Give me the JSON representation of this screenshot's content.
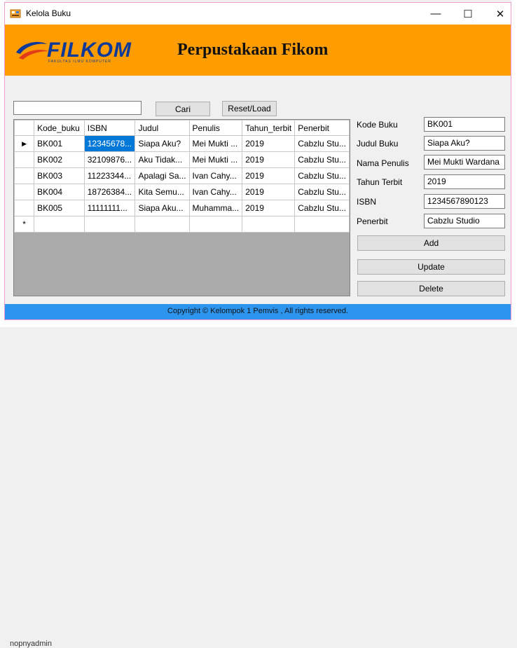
{
  "window": {
    "title": "Kelola Buku",
    "minimize_glyph": "—",
    "maximize_glyph": "☐",
    "close_glyph": "✕"
  },
  "header": {
    "logo_text": "FILKOM",
    "logo_subtext": "FAKULTAS ILMU KOMPUTER",
    "title": "Perpustakaan Fikom",
    "background_color": "#ff9d00"
  },
  "search": {
    "value": "",
    "search_label": "Cari",
    "reset_label": "Reset/Load"
  },
  "grid": {
    "columns": [
      "Kode_buku",
      "ISBN",
      "Judul",
      "Penulis",
      "Tahun_terbit",
      "Penerbit"
    ],
    "rows": [
      [
        "BK001",
        "12345678...",
        "Siapa Aku?",
        "Mei Mukti ...",
        "2019",
        "Cabzlu Stu..."
      ],
      [
        "BK002",
        "32109876...",
        "Aku Tidak...",
        "Mei Mukti ...",
        "2019",
        "Cabzlu Stu..."
      ],
      [
        "BK003",
        "11223344...",
        "Apalagi Sa...",
        "Ivan Cahy...",
        "2019",
        "Cabzlu Stu..."
      ],
      [
        "BK004",
        "18726384...",
        "Kita Semu...",
        "Ivan Cahy...",
        "2019",
        "Cabzlu Stu..."
      ],
      [
        "BK005",
        "11111111...",
        "Siapa Aku...",
        "Muhamma...",
        "2019",
        "Cabzlu Stu..."
      ]
    ],
    "current_row_marker": "▶",
    "new_row_marker": "*",
    "selected_color": "#0078d7"
  },
  "form": {
    "kode_label": "Kode Buku",
    "kode_value": "BK001",
    "judul_label": "Judul Buku",
    "judul_value": "Siapa Aku?",
    "penulis_label": "Nama Penulis",
    "penulis_value": "Mei Mukti Wardana",
    "tahun_label": "Tahun Terbit",
    "tahun_value": "2019",
    "isbn_label": "ISBN",
    "isbn_value": "1234567890123",
    "penerbit_label": "Penerbit",
    "penerbit_value": "Cabzlu Studio",
    "add_label": "Add",
    "update_label": "Update",
    "delete_label": "Delete"
  },
  "footer": {
    "text": "Copyright © Kelompok 1 Pemvis , All rights reserved.",
    "background_color": "#2e95ef"
  },
  "background": {
    "bottom_fragment": "nopnyadmin"
  }
}
